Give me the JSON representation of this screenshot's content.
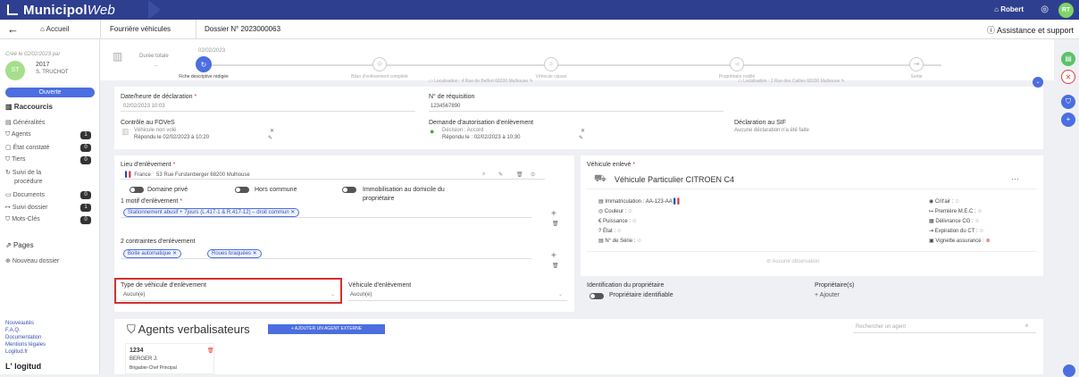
{
  "topbar": {
    "brand_main": "Municipol",
    "brand_italic": "Web",
    "user": "Robert",
    "avatar": "RT"
  },
  "nav": {
    "home": "Accueil",
    "module": "Fourrière véhicules",
    "dossier": "Dossier N° 2023000063",
    "assist": "Assistance et support"
  },
  "sidebar": {
    "created": "Créé le 02/02/2023 par",
    "avatar": "ST",
    "year": "2017",
    "who": "S. TRUCHOT",
    "status": "Ouverte",
    "shortcuts": "Raccourcis",
    "items": [
      {
        "label": "Généralités",
        "badge": ""
      },
      {
        "label": "Agents",
        "badge": "1"
      },
      {
        "label": "État constaté",
        "badge": "0"
      },
      {
        "label": "Tiers",
        "badge": "0"
      },
      {
        "label": "Suivi de la",
        "badge": ""
      },
      {
        "label": "procédure",
        "badge": ""
      },
      {
        "label": "Documents",
        "badge": "0"
      },
      {
        "label": "Suivi dossier",
        "badge": "1"
      },
      {
        "label": "Mots-Clés",
        "badge": "0"
      }
    ],
    "pages": "Pages",
    "new_dossier": "Nouveau dossier",
    "links": [
      "Nouveautés",
      "F.A.Q.",
      "Documentation",
      "Mentions légales",
      "Logitud.fr"
    ],
    "logo": "logitud"
  },
  "progress": {
    "duration_label": "Durée totale",
    "duration_value": "...",
    "date": "02/02/2023",
    "steps": [
      "Fiche descriptive rédigée",
      "Bilan d'enlèvement complété",
      "Véhicule classé",
      "Propriétaire notifié",
      "Sortie"
    ],
    "loc1": "Localisation : 4 Rue de Belfort 68200 Mulhouse",
    "loc2": "Localisation : 2 Rue des Cailles 68200 Mulhouse"
  },
  "decl": {
    "date_label": "Date/heure de déclaration",
    "date_value": "02/02/2023 10:03",
    "req_label": "N° de réquisition",
    "req_value": "1234567890",
    "foves_label": "Contrôle au FOVeS",
    "foves_line1": "Véhicule non volé",
    "foves_line2": "Répondu le 02/02/2023 à 10:20",
    "auth_label": "Demande d'autorisation d'enlèvement",
    "auth_line1": "Décision : Accord",
    "auth_line2": "Répondu le : 02/02/2023 à 10:30",
    "sif_label": "Déclaration au SIF",
    "sif_value": "Aucune déclaration n'a été faite"
  },
  "lieu": {
    "label": "Lieu d'enlèvement",
    "country": "France",
    "address": "53 Rue Furstenberger 68200 Mulhouse",
    "t1": "Domaine privé",
    "t2": "Hors commune",
    "t3": "Immobilisation au domicile du",
    "t3b": "propriétaire",
    "motif_label": "1 motif d'enlèvement",
    "motif_chip": "Stationnement abusif + 7jours (L.417-1 & R.417-12) – droit commun",
    "contraintes_label": "2 contraintes d'enlèvement",
    "c1": "Boite automatique",
    "c2": "Roues braquées",
    "type_label": "Type de véhicule d'enlèvement",
    "type_value": "Aucun(e)",
    "veh_label": "Véhicule d'enlèvement",
    "veh_value": "Aucun(e)"
  },
  "vehicule": {
    "label": "Véhicule enlevé",
    "title": "Véhicule Particulier CITROEN C4",
    "more": "···",
    "immat": "Immatriculation : AA-123-AA",
    "couleur": "Couleur :",
    "puissance": "Puissance :",
    "etat": "État :",
    "serie": "N° de Série :",
    "critair": "Crit'air :",
    "premiere": "Première M.E.C :",
    "delivrance": "Délivrance CG :",
    "expiration": "Expiration du CT :",
    "vignette": "Vignette assurance :",
    "obs": "Aucune observation"
  },
  "proprio": {
    "id_label": "Identification du propriétaire",
    "id_toggle": "Propriétaire identifiable",
    "p_label": "Propriétaire(s)",
    "add": "+ Ajouter"
  },
  "agents": {
    "title": "Agents verbalisateurs",
    "add_btn": "+ AJOUTER UN AGENT EXTERNE",
    "search_ph": "Rechercher un agent",
    "num": "1234",
    "name": "BERGER J.",
    "rank": "Brigadier-Chef Principal"
  }
}
